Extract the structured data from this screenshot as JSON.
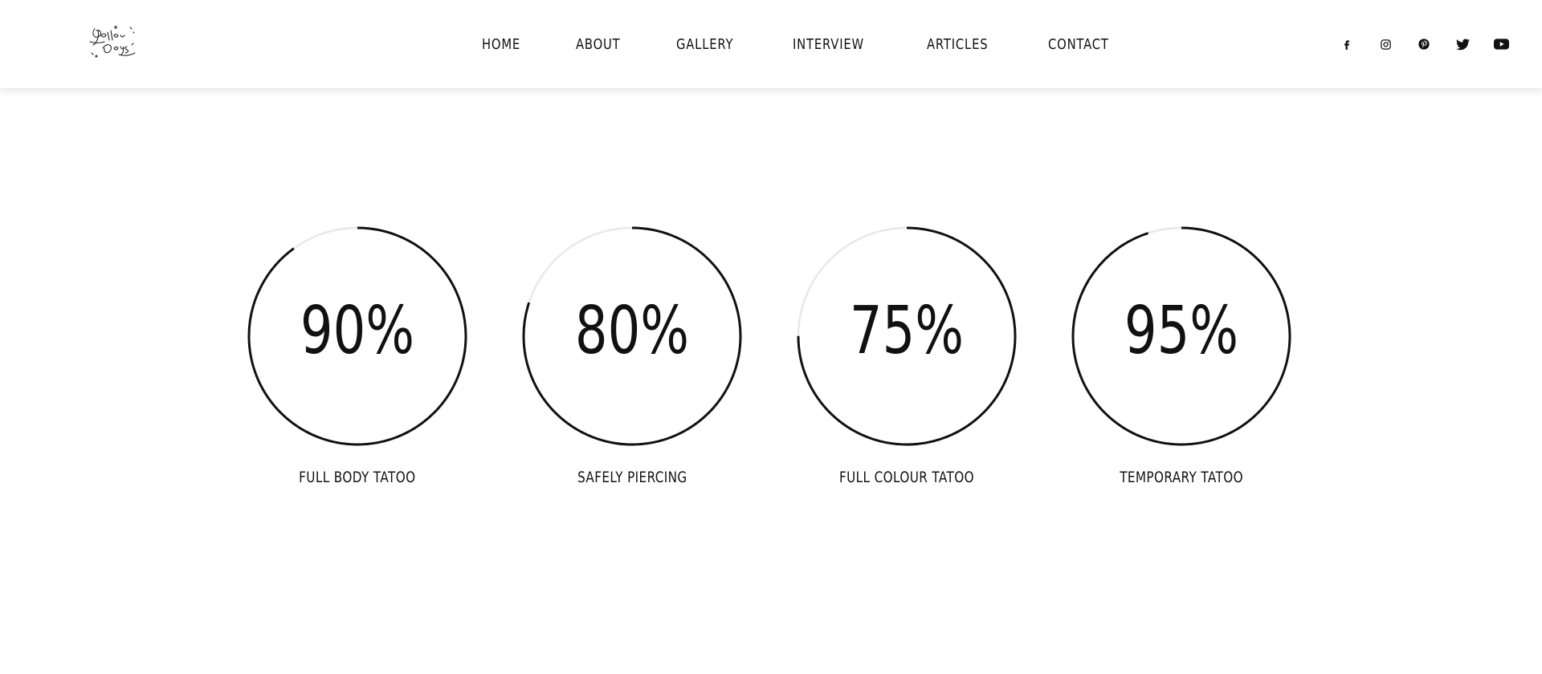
{
  "header": {
    "logo_text": "Better Days",
    "nav": [
      {
        "label": "HOME"
      },
      {
        "label": "ABOUT"
      },
      {
        "label": "GALLERY"
      },
      {
        "label": "INTERVIEW"
      },
      {
        "label": "ARTICLES"
      },
      {
        "label": "CONTACT"
      }
    ],
    "social": [
      {
        "icon": "facebook-icon"
      },
      {
        "icon": "instagram-icon"
      },
      {
        "icon": "pinterest-icon"
      },
      {
        "icon": "twitter-icon"
      },
      {
        "icon": "youtube-icon"
      }
    ]
  },
  "skills": [
    {
      "percent_label": "90%",
      "value": 0.9,
      "label": "FULL BODY TATOO"
    },
    {
      "percent_label": "80%",
      "value": 0.8,
      "label": "SAFELY PIERCING"
    },
    {
      "percent_label": "75%",
      "value": 0.75,
      "label": "FULL COLOUR TATOO"
    },
    {
      "percent_label": "95%",
      "value": 0.95,
      "label": "TEMPORARY TATOO"
    }
  ],
  "colors": {
    "ring_progress": "#111111",
    "ring_track": "#e8e8e8",
    "text": "#111111",
    "background": "#ffffff"
  }
}
